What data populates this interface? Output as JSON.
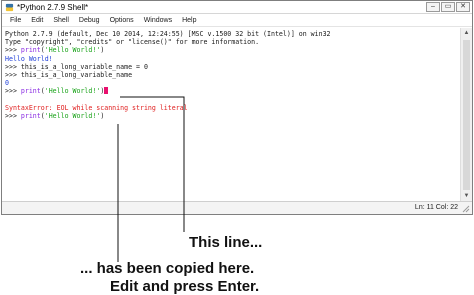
{
  "window": {
    "title": "*Python 2.7.9 Shell*",
    "controls": {
      "minimize": "–",
      "maximize": "▭",
      "close": "✕"
    }
  },
  "menu": [
    "File",
    "Edit",
    "Shell",
    "Debug",
    "Options",
    "Windows",
    "Help"
  ],
  "shell_lines": [
    [
      {
        "t": "Python 2.7.9 (default, Dec 10 2014, 12:24:55) [MSC v.1500 32 bit (Intel)] on win32",
        "c": "black"
      }
    ],
    [
      {
        "t": "Type \"copyright\", \"credits\" or \"license()\" for more information.",
        "c": "black"
      }
    ],
    [
      {
        "t": ">>> ",
        "c": "black"
      },
      {
        "t": "print",
        "c": "purple"
      },
      {
        "t": "(",
        "c": "black"
      },
      {
        "t": "'Hello World!'",
        "c": "green"
      },
      {
        "t": ")",
        "c": "black"
      }
    ],
    [
      {
        "t": "Hello World!",
        "c": "blue"
      }
    ],
    [
      {
        "t": ">>> this_is_a_long_variable_name = 0",
        "c": "black"
      }
    ],
    [
      {
        "t": ">>> this_is_a_long_variable_name",
        "c": "black"
      }
    ],
    [
      {
        "t": "0",
        "c": "blue"
      }
    ],
    [
      {
        "t": ">>> ",
        "c": "black"
      },
      {
        "t": "print",
        "c": "purple"
      },
      {
        "t": "(",
        "c": "black"
      },
      {
        "t": "'Hello World!'",
        "c": "green"
      },
      {
        "t": ")",
        "c": "black"
      },
      {
        "t": "",
        "c": "cursor"
      }
    ],
    [
      {
        "t": "",
        "c": "black"
      }
    ],
    [
      {
        "t": "SyntaxError: EOL while scanning string literal",
        "c": "red"
      }
    ],
    [
      {
        "t": ">>> ",
        "c": "black"
      },
      {
        "t": "print",
        "c": "purple"
      },
      {
        "t": "(",
        "c": "black"
      },
      {
        "t": "'Hello World!'",
        "c": "green"
      },
      {
        "t": ")",
        "c": "black"
      }
    ]
  ],
  "status": {
    "position": "Ln: 11 Col: 22"
  },
  "colors": {
    "black": "#1a1a1a",
    "blue": "#1f3fd8",
    "red": "#e02020",
    "green": "#19a319",
    "purple": "#8a2be2",
    "cursor": "#e8106e"
  },
  "annotations": {
    "this_line": "This line...",
    "copied_here": "... has been copied here.",
    "edit_enter": "Edit and press Enter."
  }
}
